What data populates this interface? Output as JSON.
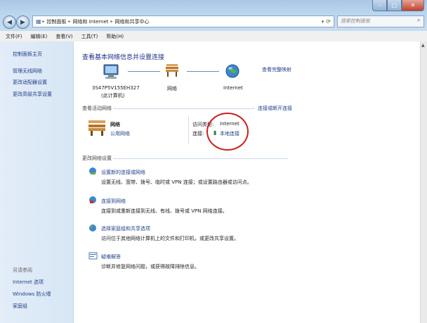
{
  "addressbar": {
    "crumbs": [
      "控制面板",
      "网络和 Internet",
      "网络和共享中心"
    ]
  },
  "search": {
    "placeholder": "搜索控制面板"
  },
  "menu": [
    "文件(F)",
    "编辑(E)",
    "查看(V)",
    "工具(T)",
    "帮助(H)"
  ],
  "sidebar": {
    "home": "控制面板主页",
    "items": [
      "管理无线网络",
      "更改适配器设置",
      "更改高级共享设置"
    ],
    "see_also_title": "另请参阅",
    "see_also": [
      "Internet 选项",
      "Windows 防火墙",
      "家庭组"
    ]
  },
  "main": {
    "title": "查看基本网络信息并设置连接",
    "view_full_map": "查看完整映射",
    "map": {
      "computer_name": "3S47P5V155EH327",
      "computer_sub": "(此计算机)",
      "network_label": "网络",
      "internet_label": "Internet"
    },
    "active_networks_label": "查看活动网络",
    "connect_disconnect": "连接或断开连接",
    "network": {
      "name": "网络",
      "type": "公用网络",
      "access_type_label": "访问类型:",
      "access_type_value": "Internet",
      "connections_label": "连接:",
      "connections_value": "本地连接"
    },
    "change_settings_label": "更改网络设置",
    "tasks": [
      {
        "title": "设置新的连接或网络",
        "desc": "设置无线、宽带、拨号、临时或 VPN 连接；或设置路由器或访问点。"
      },
      {
        "title": "连接到网络",
        "desc": "连接到或重新连接到无线、有线、拨号或 VPN 网络连接。"
      },
      {
        "title": "选择家庭组和共享选项",
        "desc": "访问位于其他网络计算机上的文件和打印机，或更改共享设置。"
      },
      {
        "title": "疑难解答",
        "desc": "诊断并修复网络问题，或获得故障排除信息。"
      }
    ]
  },
  "colors": {
    "link": "#1f3f8a",
    "annotation_circle": "#cc1f1f"
  }
}
